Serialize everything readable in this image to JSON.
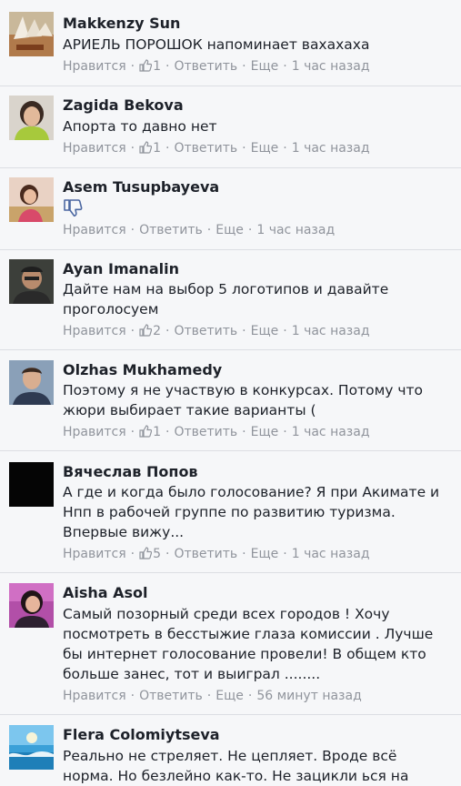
{
  "actions": {
    "like": "Нравится",
    "reply": "Ответить",
    "more": "Еще"
  },
  "comments": [
    {
      "name": "Makkenzy Sun",
      "lines": [
        "АРИЕЛЬ ПОРОШОК напоминает вахахаха"
      ],
      "likes": "1",
      "time": "1 час назад"
    },
    {
      "name": "Zagida Bekova",
      "lines": [
        "Апорта то давно нет"
      ],
      "likes": "1",
      "time": "1 час назад"
    },
    {
      "name": "Asem Tusupbayeva",
      "lines": [],
      "likes": "",
      "time": "1 час назад"
    },
    {
      "name": "Ayan Imanalin",
      "lines": [
        "Дайте нам на выбор 5 логотипов и давайте",
        "проголосуем"
      ],
      "likes": "2",
      "time": "1 час назад"
    },
    {
      "name": "Olzhas Mukhamedy",
      "lines": [
        "Поэтому я не участвую в конкурсах. Потому что",
        "жюри выбирает такие варианты ("
      ],
      "likes": "1",
      "time": "1 час назад"
    },
    {
      "name": "Вячеслав Попов",
      "lines": [
        "А где и когда было голосование? Я при Акимате и",
        "Нпп в рабочей группе по развитию туризма.",
        "Впервые вижу..."
      ],
      "likes": "5",
      "time": "1 час назад"
    },
    {
      "name": "Aisha Asol",
      "lines": [
        "Самый позорный среди всех городов ! Хочу",
        "посмотреть в бесстыжие глаза комиссии . Лучше",
        "бы интернет голосование провели! В общем кто",
        "больше занес, тот и выиграл ........"
      ],
      "likes": "",
      "time": "56 минут назад"
    },
    {
      "name": "Flera Colomiytseva",
      "lines": [
        "Реально не стреляет. Не цепляет. Вроде всё",
        "норма. Но безлейно как-то. Не зацикли ься на"
      ],
      "likes": "",
      "time": ""
    }
  ]
}
